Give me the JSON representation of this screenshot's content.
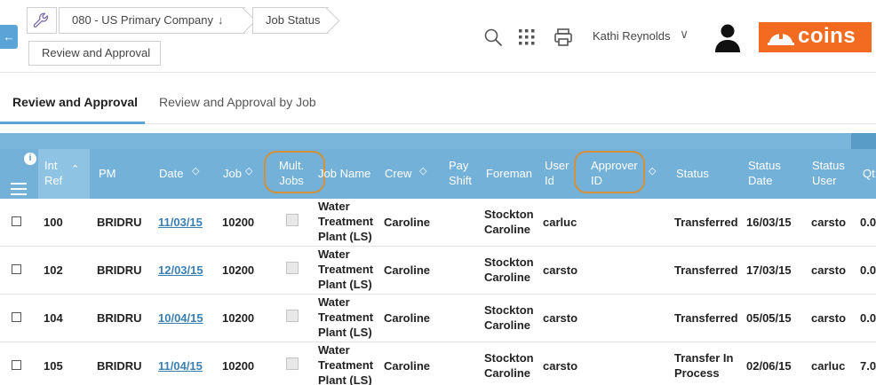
{
  "breadcrumb": {
    "company": "080 - US Primary Company",
    "page": "Job Status",
    "current": "Review and Approval"
  },
  "header": {
    "user_name": "Kathi Reynolds",
    "logo_text": "coins"
  },
  "tabs": [
    {
      "label": "Review and Approval",
      "active": true
    },
    {
      "label": "Review and Approval by Job",
      "active": false
    }
  ],
  "grid": {
    "info_badge": "i",
    "headers": {
      "int_ref": [
        "Int",
        "Ref"
      ],
      "pm": "PM",
      "date": "Date",
      "job": "Job",
      "mult_jobs": [
        "Mult.",
        "Jobs"
      ],
      "job_name": "Job Name",
      "crew": "Crew",
      "pay_shift": [
        "Pay",
        "Shift"
      ],
      "foreman": "Foreman",
      "user_id": [
        "User",
        "Id"
      ],
      "approver_id": [
        "Approver",
        "ID"
      ],
      "status": "Status",
      "status_date": [
        "Status",
        "Date"
      ],
      "status_user": [
        "Status",
        "User"
      ],
      "qty": "Qt"
    },
    "rows": [
      {
        "int_ref": "100",
        "pm": "BRIDRU",
        "date": "11/03/15",
        "job": "10200",
        "job_name": [
          "Water",
          "Treatment",
          "Plant (LS)"
        ],
        "crew": "Caroline",
        "foreman": [
          "Stockton",
          "Caroline"
        ],
        "user_id": "carluc",
        "status": [
          "Transferred"
        ],
        "status_date": "16/03/15",
        "status_user": "carsto",
        "qty": "0.0"
      },
      {
        "int_ref": "102",
        "pm": "BRIDRU",
        "date": "12/03/15",
        "job": "10200",
        "job_name": [
          "Water",
          "Treatment",
          "Plant (LS)"
        ],
        "crew": "Caroline",
        "foreman": [
          "Stockton",
          "Caroline"
        ],
        "user_id": "carsto",
        "status": [
          "Transferred"
        ],
        "status_date": "17/03/15",
        "status_user": "carsto",
        "qty": "0.0"
      },
      {
        "int_ref": "104",
        "pm": "BRIDRU",
        "date": "10/04/15",
        "job": "10200",
        "job_name": [
          "Water",
          "Treatment",
          "Plant (LS)"
        ],
        "crew": "Caroline",
        "foreman": [
          "Stockton",
          "Caroline"
        ],
        "user_id": "carsto",
        "status": [
          "Transferred"
        ],
        "status_date": "05/05/15",
        "status_user": "carsto",
        "qty": "0.0"
      },
      {
        "int_ref": "105",
        "pm": "BRIDRU",
        "date": "11/04/15",
        "job": "10200",
        "job_name": [
          "Water",
          "Treatment",
          "Plant (LS)"
        ],
        "crew": "Caroline",
        "foreman": [
          "Stockton",
          "Caroline"
        ],
        "user_id": "carsto",
        "status": [
          "Transfer In",
          "Process"
        ],
        "status_date": "02/06/15",
        "status_user": "carluc",
        "qty": "7.0"
      }
    ]
  },
  "colors": {
    "accent": "#5ba4d8",
    "header_bg": "#74b1d9",
    "logo_bg": "#f26b21",
    "highlight_ring": "#d2913a",
    "link": "#3b7fb3"
  }
}
